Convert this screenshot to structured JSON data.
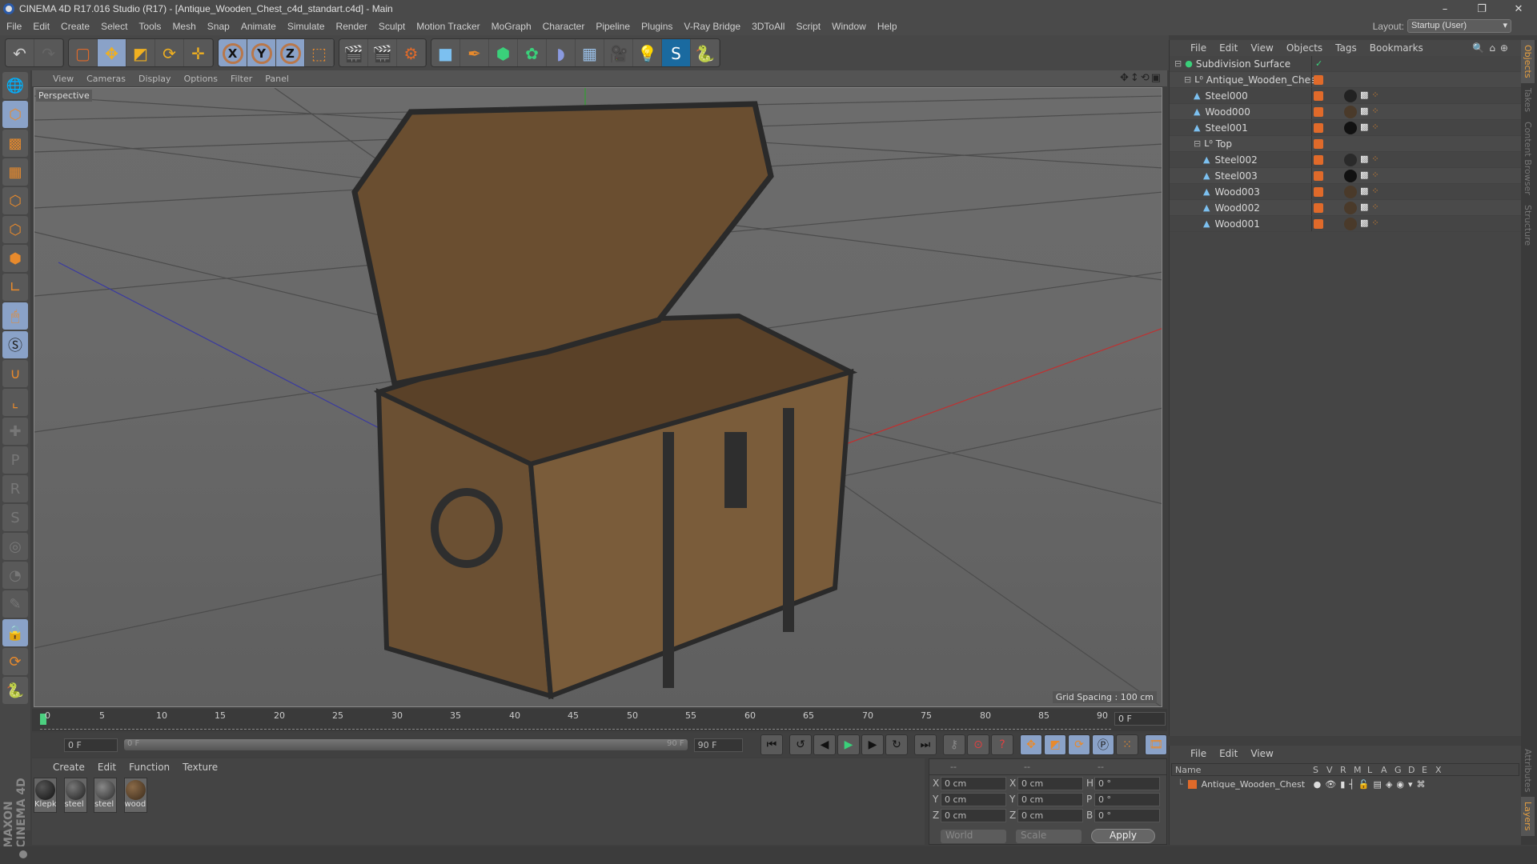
{
  "window": {
    "title": "CINEMA 4D R17.016 Studio (R17) - [Antique_Wooden_Chest_c4d_standart.c4d] - Main",
    "controls": [
      "minimize",
      "restore",
      "close"
    ]
  },
  "menu": [
    "File",
    "Edit",
    "Create",
    "Select",
    "Tools",
    "Mesh",
    "Snap",
    "Animate",
    "Simulate",
    "Render",
    "Sculpt",
    "Motion Tracker",
    "MoGraph",
    "Character",
    "Pipeline",
    "Plugins",
    "V-Ray Bridge",
    "3DToAll",
    "Script",
    "Window",
    "Help"
  ],
  "layout": {
    "label": "Layout:",
    "value": "Startup (User)"
  },
  "viewport": {
    "menu": [
      "View",
      "Cameras",
      "Display",
      "Options",
      "Filter",
      "Panel"
    ],
    "camera": "Perspective",
    "grid_spacing": "Grid Spacing : 100 cm"
  },
  "timeline": {
    "ticks": [
      "0",
      "5",
      "10",
      "15",
      "20",
      "25",
      "30",
      "35",
      "40",
      "45",
      "50",
      "55",
      "60",
      "65",
      "70",
      "75",
      "80",
      "85",
      "90"
    ],
    "current_frame": "0 F",
    "start": "0 F",
    "range_start": "0 F",
    "range_end": "90 F",
    "end": "90 F"
  },
  "materials": {
    "menu": [
      "Create",
      "Edit",
      "Function",
      "Texture"
    ],
    "items": [
      {
        "name": "Klepk",
        "color": "#1c1c1c"
      },
      {
        "name": "steel",
        "color": "#2e2e2e"
      },
      {
        "name": "steel",
        "color": "#3a3a3a"
      },
      {
        "name": "wood",
        "color": "#5a4632"
      }
    ]
  },
  "coordinates": {
    "headers": [
      "--",
      "--",
      "--"
    ],
    "rows": [
      {
        "a1": "X",
        "v1": "0 cm",
        "a2": "X",
        "v2": "0 cm",
        "a3": "H",
        "v3": "0 °"
      },
      {
        "a1": "Y",
        "v1": "0 cm",
        "a2": "Y",
        "v2": "0 cm",
        "a3": "P",
        "v3": "0 °"
      },
      {
        "a1": "Z",
        "v1": "0 cm",
        "a2": "Z",
        "v2": "0 cm",
        "a3": "B",
        "v3": "0 °"
      }
    ],
    "mode": "World",
    "type": "Scale",
    "apply": "Apply"
  },
  "objects": {
    "menu": [
      "File",
      "Edit",
      "View",
      "Objects",
      "Tags",
      "Bookmarks"
    ],
    "items": [
      {
        "name": "Subdivision Surface",
        "depth": 0,
        "type": "subdivision"
      },
      {
        "name": "Antique_Wooden_Chest",
        "depth": 1,
        "type": "null"
      },
      {
        "name": "Steel000",
        "depth": 2,
        "type": "polygon"
      },
      {
        "name": "Wood000",
        "depth": 2,
        "type": "polygon"
      },
      {
        "name": "Steel001",
        "depth": 2,
        "type": "polygon"
      },
      {
        "name": "Top",
        "depth": 2,
        "type": "null"
      },
      {
        "name": "Steel002",
        "depth": 3,
        "type": "polygon"
      },
      {
        "name": "Steel003",
        "depth": 3,
        "type": "polygon"
      },
      {
        "name": "Wood003",
        "depth": 3,
        "type": "polygon"
      },
      {
        "name": "Wood002",
        "depth": 3,
        "type": "polygon"
      },
      {
        "name": "Wood001",
        "depth": 3,
        "type": "polygon"
      }
    ]
  },
  "layers": {
    "menu": [
      "File",
      "Edit",
      "View"
    ],
    "columns": [
      "Name",
      "S",
      "V",
      "R",
      "M",
      "L",
      "A",
      "G",
      "D",
      "E",
      "X"
    ],
    "rows": [
      {
        "name": "Antique_Wooden_Chest"
      }
    ]
  },
  "side_tabs": [
    "Objects",
    "Takes",
    "Content Browser",
    "Structure"
  ],
  "side_tabs_bottom": [
    "Attributes",
    "Layers"
  ],
  "brand": "MAXON CINEMA 4D"
}
